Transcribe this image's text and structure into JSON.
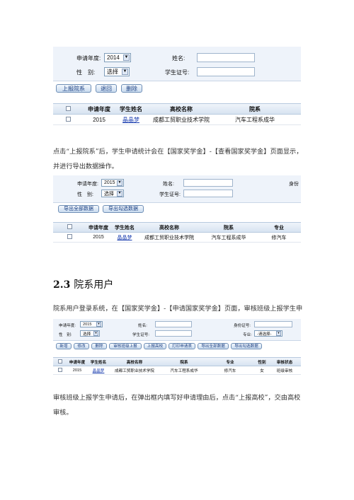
{
  "shot1": {
    "year_label": "申请年度:",
    "year_value": "2014",
    "gender_label": "性　别:",
    "gender_value": "选择",
    "name_label": "姓名:",
    "student_id_label": "学生证号:",
    "buttons": [
      "上报院系",
      "退回",
      "删除"
    ],
    "headers": [
      "申请年度",
      "学生姓名",
      "高校名称",
      "院系"
    ],
    "rows": [
      [
        "2015",
        "晶晶梦",
        "成都工贸职业技术学院",
        "汽车工程系成华"
      ]
    ]
  },
  "para1": "点击“上报院系”后，学生申请统计会在【国家奖学金】-【查看国家奖学金】页面显示，并进行导出数据操作。",
  "shot2": {
    "year_label": "申请年度:",
    "year_value": "2015",
    "gender_label": "性　别:",
    "gender_value": "选择",
    "name_label": "姓名:",
    "student_id_label": "学生证号:",
    "id_card_label": "身份",
    "buttons": [
      "导出全部数据",
      "导出勾选数据"
    ],
    "headers": [
      "申请年度",
      "学生姓名",
      "高校名称",
      "院系",
      "专业"
    ],
    "rows": [
      [
        "2015",
        "晶晶梦",
        "成都工贸职业技术学院",
        "汽车工程系成华",
        "修汽车"
      ]
    ]
  },
  "section": {
    "number": "2.3",
    "title": "院系用户"
  },
  "para2": "院系用户登录系统，在【国家奖学金】-【申请国家奖学金】页面，审核班级上报学生申请。",
  "shot3": {
    "year_label": "申请年度:",
    "year_value": "2015",
    "gender_label": "性　别:",
    "gender_value": "选择",
    "name_label": "姓名:",
    "student_id_label": "学生证号:",
    "id_card_label": "身份证号:",
    "major_label": "专业:",
    "major_value": "-请选择-",
    "buttons": [
      "新增",
      "修改",
      "删除",
      "审核班级上报",
      "上报高校",
      "打印申请表",
      "导出全部数据",
      "导出勾选数据"
    ],
    "headers": [
      "申请年度",
      "学生姓名",
      "高校名称",
      "院系",
      "专业",
      "性别",
      "审核状态"
    ],
    "rows": [
      [
        "2015",
        "晶晶梦",
        "成都工贸职业技术学院",
        "汽车工程系成华",
        "修汽车",
        "女",
        "班级审核"
      ]
    ]
  },
  "para3": "审核班级上报学生申请后，在弹出框内填写好申请理由后，点击“上报高校”，交由高校审核。"
}
